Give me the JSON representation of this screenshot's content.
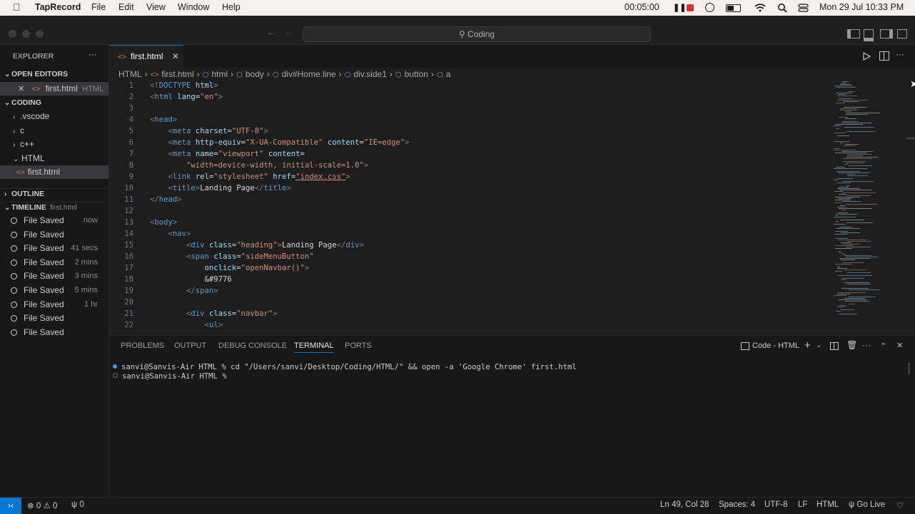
{
  "menubar": {
    "apple_icon": "apple-icon",
    "app": "TapRecord",
    "items": [
      "File",
      "Edit",
      "View",
      "Window",
      "Help"
    ],
    "timer": "00:05:00",
    "datetime": "Mon 29 Jul  10:33 PM"
  },
  "titlebar": {
    "search": "Coding"
  },
  "explorer": {
    "title": "EXPLORER",
    "more": "···",
    "open_editors": "OPEN EDITORS",
    "open_file": "first.html",
    "open_file_lang": "HTML",
    "workspace": "CODING",
    "tree": [
      ".vscode",
      "c",
      "c++",
      "HTML",
      "first.html"
    ],
    "outline": "OUTLINE",
    "timeline": "TIMELINE",
    "timeline_file": "first.html",
    "timeline_items": [
      {
        "label": "File Saved",
        "time": "now"
      },
      {
        "label": "File Saved",
        "time": ""
      },
      {
        "label": "File Saved",
        "time": "41 secs"
      },
      {
        "label": "File Saved",
        "time": "2 mins"
      },
      {
        "label": "File Saved",
        "time": "3 mins"
      },
      {
        "label": "File Saved",
        "time": "5 mins"
      },
      {
        "label": "File Saved",
        "time": "1 hr"
      },
      {
        "label": "File Saved",
        "time": ""
      },
      {
        "label": "File Saved",
        "time": ""
      }
    ]
  },
  "editor": {
    "tab": "first.html",
    "breadcrumb": [
      "HTML",
      "first.html",
      "html",
      "body",
      "div#Home.line",
      "div.side1",
      "button",
      "a"
    ],
    "line_numbers": [
      "1",
      "2",
      "3",
      "4",
      "5",
      "6",
      "7",
      "8",
      "9",
      "10",
      "11",
      "12",
      "13",
      "14",
      "15",
      "16",
      "17",
      "18",
      "19",
      "20",
      "21",
      "22"
    ]
  },
  "panel": {
    "tabs": [
      "PROBLEMS",
      "OUTPUT",
      "DEBUG CONSOLE",
      "TERMINAL",
      "PORTS"
    ],
    "terminal_name": "Code - HTML",
    "line1": "sanvi@Sanvis-Air HTML % cd \"/Users/sanvi/Desktop/Coding/HTML/\" && open -a 'Google Chrome' first.html",
    "line2": "sanvi@Sanvis-Air HTML % "
  },
  "statusbar": {
    "errors": "0",
    "warnings": "0",
    "ports": "0",
    "position": "Ln 49, Col 28",
    "spaces": "Spaces: 4",
    "encoding": "UTF-8",
    "eol": "LF",
    "language": "HTML",
    "golive": "Go Live"
  },
  "colors": {
    "accent": "#0078d4",
    "tag": "#569cd6",
    "attr": "#9cdcfe",
    "string": "#ce9178",
    "record": "#e02d2d"
  }
}
